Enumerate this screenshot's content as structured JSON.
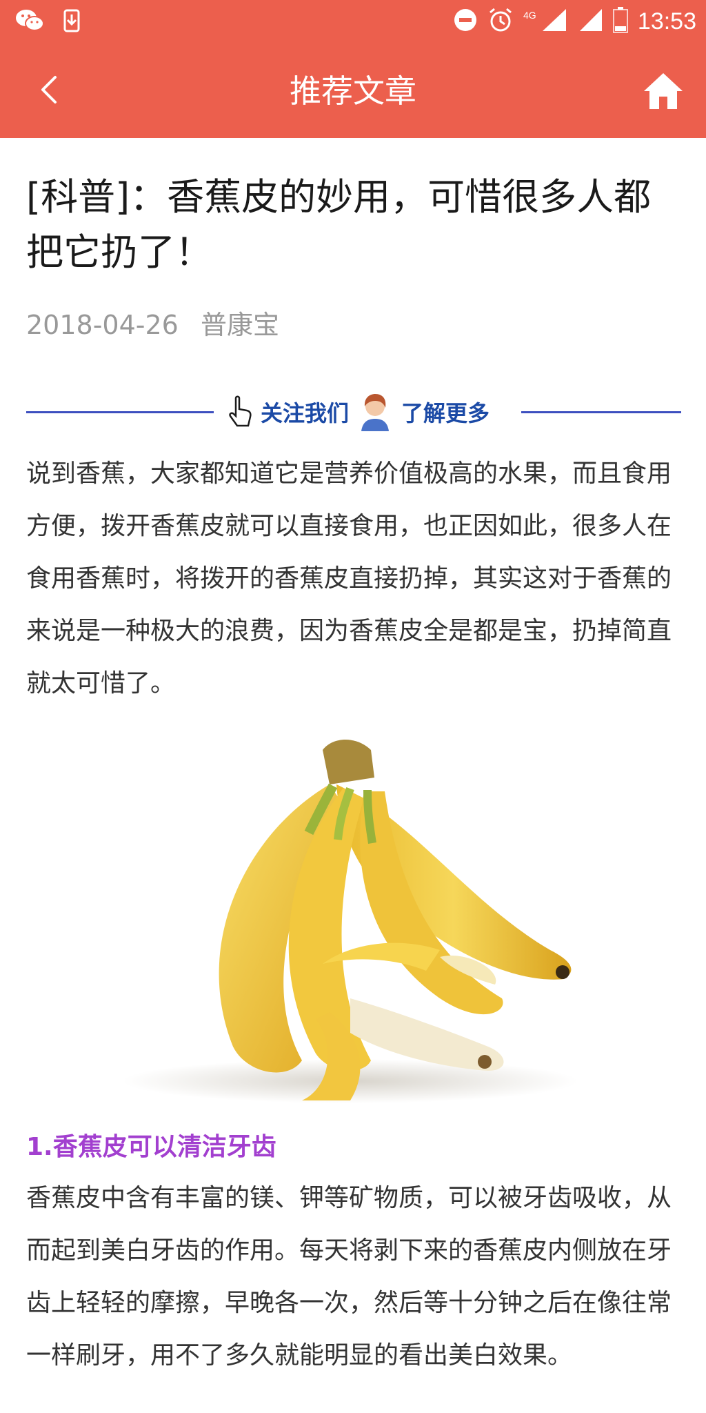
{
  "status_bar": {
    "time": "13:53",
    "network": "4G",
    "icons": [
      "wechat-icon",
      "download-icon",
      "dnd-icon",
      "alarm-icon",
      "signal-icon",
      "battery-icon"
    ]
  },
  "app_bar": {
    "title": "推荐文章",
    "back_icon": "chevron-left-icon",
    "home_icon": "home-icon",
    "color": "#ec5f4d"
  },
  "article": {
    "title": "[科普]：香蕉皮的妙用，可惜很多人都把它扔了！",
    "date": "2018-04-26",
    "source": "普康宝",
    "follow_banner": {
      "text_left": "关注我们",
      "text_right": "了解更多"
    },
    "intro": "说到香蕉，大家都知道它是营养价值极高的水果，而且食用方便，拨开香蕉皮就可以直接食用，也正因如此，很多人在食用香蕉时，将拨开的香蕉皮直接扔掉，其实这对于香蕉的来说是一种极大的浪费，因为香蕉皮全是都是宝，扔掉简直就太可惜了。",
    "image": "banana-bunch-image",
    "section1": {
      "heading": "1.香蕉皮可以清洁牙齿",
      "text": "香蕉皮中含有丰富的镁、钾等矿物质，可以被牙齿吸收，从而起到美白牙齿的作用。每天将剥下来的香蕉皮内侧放在牙齿上轻轻的摩擦，早晚各一次，然后等十分钟之后在像往常一样刷牙，用不了多久就能明显的看出美白效果。"
    }
  },
  "colors": {
    "accent": "#ec5f4d",
    "heading_purple": "#a23fcf",
    "banner_blue": "#3d4fbf",
    "meta_gray": "#999999"
  }
}
